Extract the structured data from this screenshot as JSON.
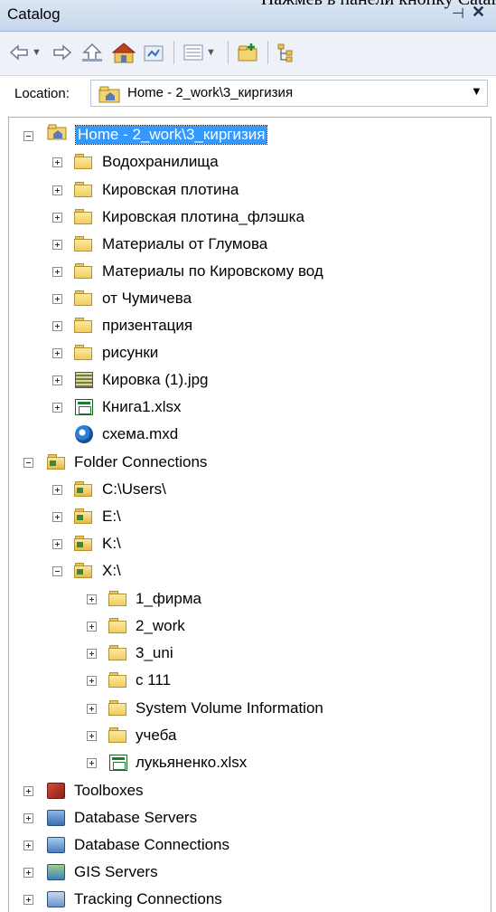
{
  "banner_text": "Нажмёв в панели кнопку Catal",
  "window": {
    "title": "Catalog",
    "pin_glyph": "⊣",
    "close_glyph": "✕"
  },
  "location": {
    "label": "Location:",
    "value": "Home - 2_work\\3_киргизия"
  },
  "tree": {
    "home": "Home - 2_work\\3_киргизия",
    "home_children": [
      "Водохранилища",
      "Кировская плотина",
      "Кировская плотина_флэшка",
      "Материалы от Глумова",
      "Материалы по Кировскому вод",
      "от Чумичева",
      "призентация",
      "рисунки",
      "Кировка (1).jpg",
      "Книга1.xlsx",
      "схема.mxd"
    ],
    "folder_connections": "Folder Connections",
    "connections": [
      "C:\\Users\\",
      "E:\\",
      "K:\\",
      "X:\\"
    ],
    "x_children": [
      "1_фирма",
      "2_work",
      "3_uni",
      "c 111",
      "System Volume Information",
      "учеба",
      "лукьяненко.xlsx"
    ],
    "roots": [
      "Toolboxes",
      "Database Servers",
      "Database Connections",
      "GIS Servers",
      "Tracking Connections"
    ]
  }
}
